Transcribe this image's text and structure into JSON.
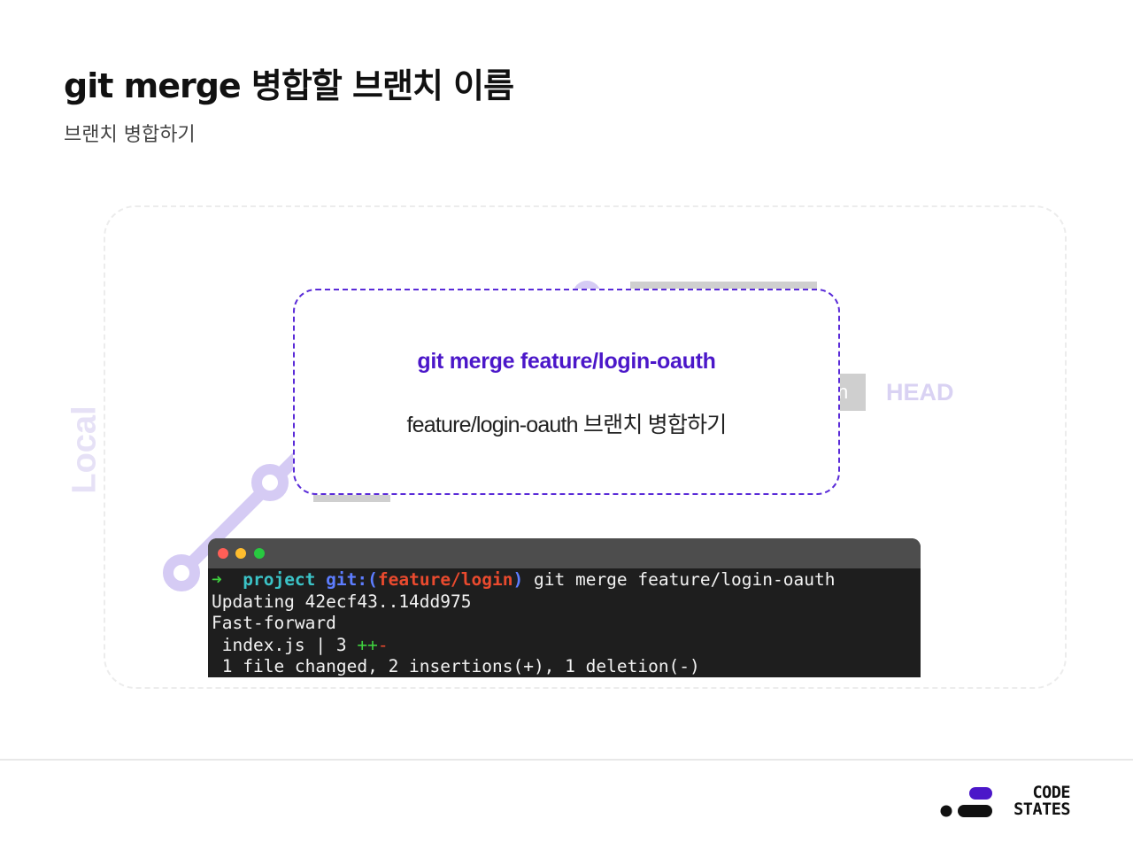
{
  "slide": {
    "title": "git merge 병합할 브랜치 이름",
    "subtitle": "브랜치 병합하기"
  },
  "diagram": {
    "side_label": "Local",
    "head_label": "HEAD",
    "branch_tag_fragment": "n",
    "accent_color": "#d5cbf4"
  },
  "callout": {
    "command": "git merge feature/login-oauth",
    "description": "feature/login-oauth 브랜치 병합하기",
    "border_color": "#5a2bd8",
    "command_color": "#4b17c9"
  },
  "terminal": {
    "prompt_arrow": "➜",
    "prompt_dir": "project",
    "prompt_git": "git:(",
    "prompt_branch": "feature/login",
    "prompt_git_close": ")",
    "command": "git merge feature/login-oauth",
    "line_updating": "Updating 42ecf43..14dd975",
    "line_fast_forward": "Fast-forward",
    "line_file": " index.js | 3 ",
    "line_file_plus": "++",
    "line_file_minus": "-",
    "line_summary": " 1 file changed, 2 insertions(+), 1 deletion(-)"
  },
  "brand": {
    "logo_line1": "CODE",
    "logo_line2": "STATES",
    "logo_color": "#4b17c9"
  }
}
